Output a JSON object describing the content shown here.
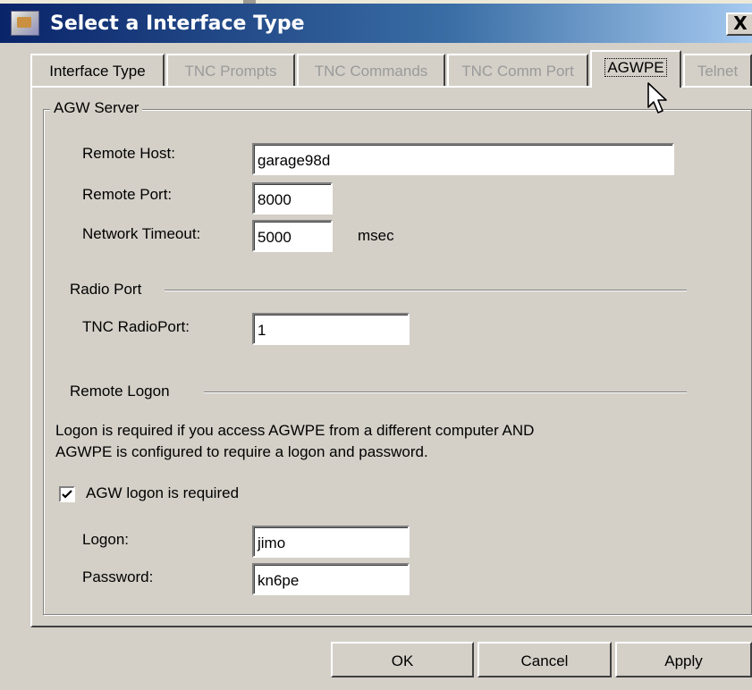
{
  "window": {
    "title": "Select a Interface Type",
    "close_label": "X"
  },
  "tabs": [
    {
      "label": "Interface Type",
      "state": "enabled"
    },
    {
      "label": "TNC Prompts",
      "state": "disabled"
    },
    {
      "label": "TNC Commands",
      "state": "disabled"
    },
    {
      "label": "TNC Comm Port",
      "state": "disabled"
    },
    {
      "label": "AGWPE",
      "state": "selected"
    },
    {
      "label": "Telnet",
      "state": "disabled"
    }
  ],
  "agw_server": {
    "group_label": "AGW Server",
    "remote_host_label": "Remote Host:",
    "remote_host_value": "garage98d",
    "remote_port_label": "Remote Port:",
    "remote_port_value": "8000",
    "network_timeout_label": "Network Timeout:",
    "network_timeout_value": "5000",
    "network_timeout_unit": "msec"
  },
  "radio_port": {
    "section_label": "Radio Port",
    "tnc_radioport_label": "TNC RadioPort:",
    "tnc_radioport_value": "1"
  },
  "remote_logon": {
    "section_label": "Remote Logon",
    "info_line1": "Logon is required if you access AGWPE from a different computer AND",
    "info_line2": "AGWPE is configured to require a logon and password.",
    "checkbox_label": "AGW logon is required",
    "checkbox_checked": true,
    "logon_label": "Logon:",
    "logon_value": "jimo",
    "password_label": "Password:",
    "password_value": "kn6pe"
  },
  "buttons": {
    "ok": "OK",
    "cancel": "Cancel",
    "apply": "Apply"
  },
  "icons": [
    "app-icon",
    "close-icon",
    "checkmark-icon",
    "mouse-cursor-icon"
  ]
}
